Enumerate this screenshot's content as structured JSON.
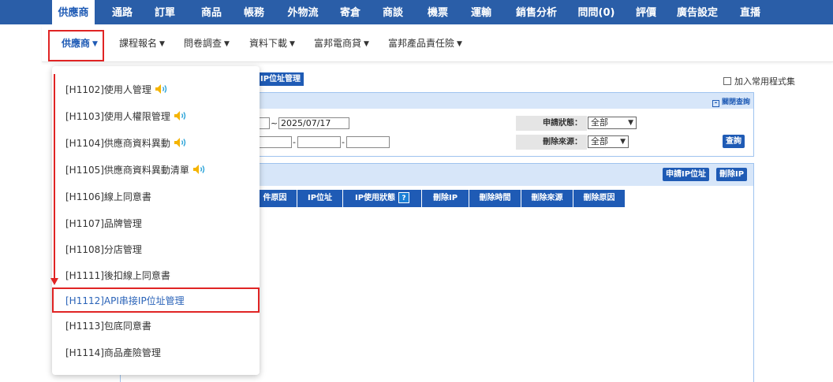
{
  "topnav": {
    "tabs": [
      {
        "label": "供應商",
        "active": true
      },
      {
        "label": "通路"
      },
      {
        "label": "訂單"
      },
      {
        "label": "商品"
      },
      {
        "label": "帳務"
      },
      {
        "label": "外物流"
      },
      {
        "label": "寄倉"
      },
      {
        "label": "商談"
      },
      {
        "label": "機票"
      },
      {
        "label": "運輸"
      },
      {
        "label": "銷售分析"
      },
      {
        "label": "問問(0)"
      },
      {
        "label": "評價"
      },
      {
        "label": "廣告設定"
      },
      {
        "label": "直播"
      }
    ]
  },
  "subnav": {
    "items": [
      {
        "label": "供應商",
        "active": true
      },
      {
        "label": "課程報名"
      },
      {
        "label": "問卷調查"
      },
      {
        "label": "資料下載"
      },
      {
        "label": "富邦電商貸"
      },
      {
        "label": "富邦產品責任險"
      }
    ]
  },
  "dropdown": {
    "items": [
      {
        "label": "[H1102]使用人管理",
        "icon": "speaker-icon"
      },
      {
        "label": "[H1103]使用人權限管理",
        "icon": "speaker-icon"
      },
      {
        "label": "[H1104]供應商資料異動",
        "icon": "speaker-icon"
      },
      {
        "label": "[H1105]供應商資料異動清單",
        "icon": "speaker-icon"
      },
      {
        "label": "[H1106]線上同意書"
      },
      {
        "label": "[H1107]品牌管理"
      },
      {
        "label": "[H1108]分店管理"
      },
      {
        "label": "[H1111]後扣線上同意書"
      },
      {
        "label": "[H1112]API串接IP位址管理",
        "selected": true
      },
      {
        "label": "[H1113]包底同意書"
      },
      {
        "label": "[H1114]商品產險管理"
      }
    ]
  },
  "page": {
    "title_fragment": "IP位址管理",
    "favorite_label": "加入常用程式集",
    "collapse_label": "關閉查詢"
  },
  "search": {
    "date_separator": "~",
    "date_end": "2025/07/17",
    "ip_separator": "-",
    "status_label": "申請狀態：",
    "status_value": "全部",
    "source_label": "刪除來源：",
    "source_value": "全部",
    "query_button": "查詢"
  },
  "results": {
    "apply_button": "申請IP位址",
    "delete_button": "刪除IP",
    "columns": [
      "件原因",
      "IP位址",
      "IP使用狀態",
      "刪除IP",
      "刪除時間",
      "刪除來源",
      "刪除原因"
    ],
    "help_mark": "?"
  },
  "colors": {
    "nav_bg": "#2a5ea8",
    "accent": "#1f5bb5",
    "highlight": "#e02424"
  }
}
